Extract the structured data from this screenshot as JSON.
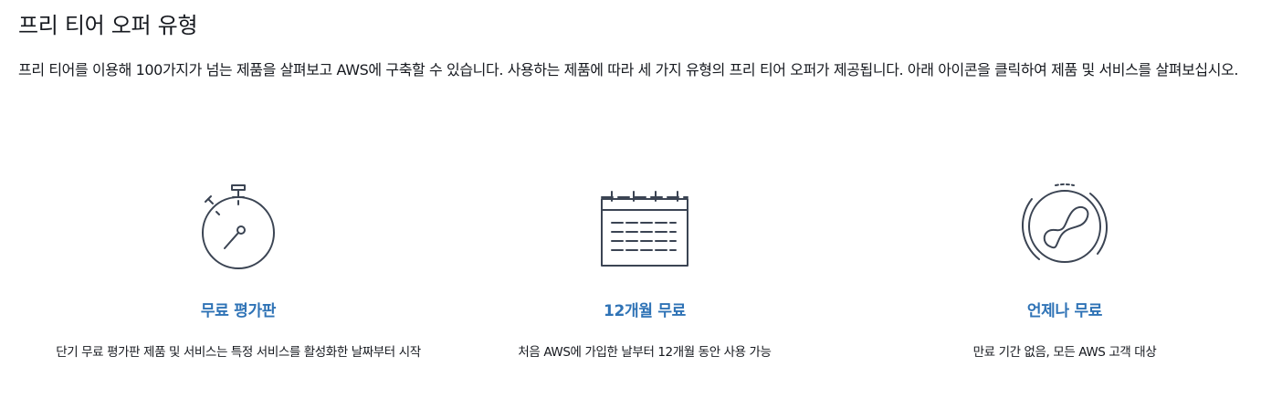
{
  "section": {
    "title": "프리 티어 오퍼 유형",
    "description": "프리 티어를 이용해 100가지가 넘는 제품을 살펴보고 AWS에 구축할 수 있습니다. 사용하는 제품에 따라 세 가지 유형의 프리 티어 오퍼가 제공됩니다. 아래 아이콘을 클릭하여 제품 및 서비스를 살펴보십시오."
  },
  "offers": [
    {
      "icon": "stopwatch-icon",
      "title": "무료 평가판",
      "description": "단기 무료 평가판 제품 및 서비스는 특정 서비스를 활성화한 날짜부터 시작"
    },
    {
      "icon": "calendar-icon",
      "title": "12개월 무료",
      "description": "처음 AWS에 가입한 날부터 12개월 동안 사용 가능"
    },
    {
      "icon": "infinity-icon",
      "title": "언제나 무료",
      "description": "만료 기간 없음, 모든 AWS 고객 대상"
    }
  ],
  "colors": {
    "accent": "#2f73b6",
    "text": "#16191f",
    "icon_stroke": "#3b4453"
  }
}
